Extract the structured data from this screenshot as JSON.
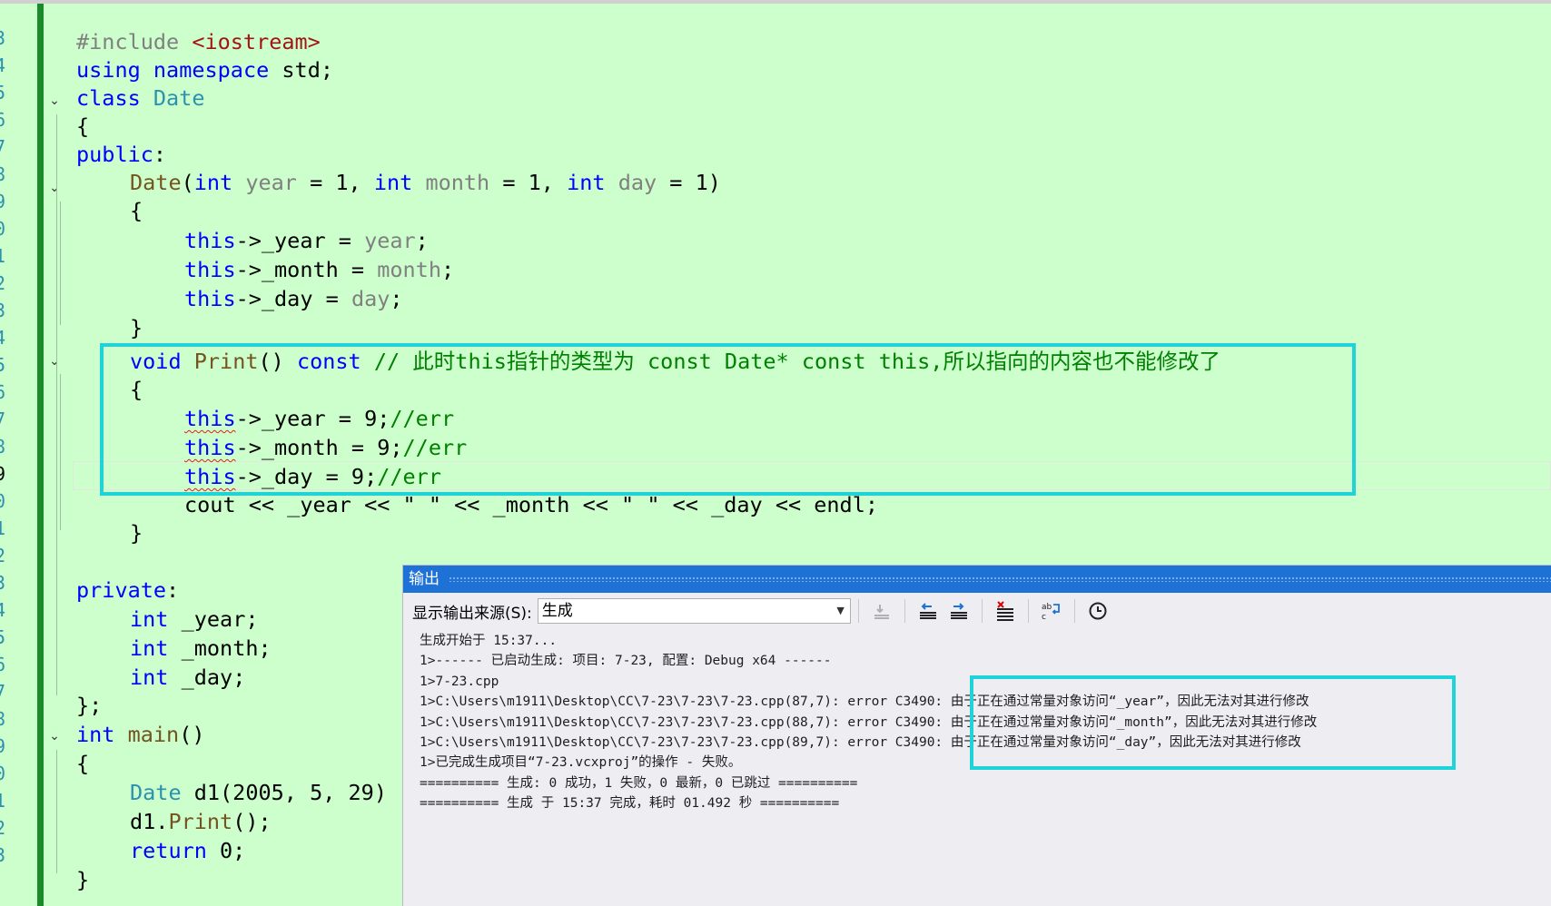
{
  "line_numbers": [
    "3",
    "4",
    "5",
    "6",
    "7",
    "8",
    "9",
    "0",
    "1",
    "2",
    "3",
    "4",
    "5",
    "6",
    "7",
    "8",
    "9",
    "0",
    "1",
    "2",
    "3",
    "4",
    "5",
    "6",
    "7",
    "8",
    "9",
    "0",
    "1",
    "2",
    "3"
  ],
  "code": {
    "l4_pp": "#include ",
    "l4_str": "<iostream>",
    "l5_kw1": "using",
    "l5_kw2": "namespace",
    "l5_rest": " std;",
    "l6_kw": "class",
    "l6_ty": "Date",
    "l7": "{",
    "l8_kw": "public",
    "l8_rest": ":",
    "l9_fn": "Date",
    "l9_p1": "(",
    "l9_int1": "int",
    "l9_year": "year",
    "l9_eq1": " = 1, ",
    "l9_int2": "int",
    "l9_month": "month",
    "l9_eq2": " = 1, ",
    "l9_int3": "int",
    "l9_day": "day",
    "l9_eq3": " = 1)",
    "l10": "{",
    "l11_this": "this",
    "l11_mid": "->_year = ",
    "l11_par": "year",
    "l11_end": ";",
    "l12_this": "this",
    "l12_mid": "->_month = ",
    "l12_par": "month",
    "l12_end": ";",
    "l13_this": "this",
    "l13_mid": "->_day = ",
    "l13_par": "day",
    "l13_end": ";",
    "l14": "}",
    "l15_void": "void",
    "l15_fn": "Print",
    "l15_paren": "() ",
    "l15_const": "const",
    "l15_comment": " // 此时this指针的类型为 const Date* const this,所以指向的内容也不能修改了",
    "l16": "{",
    "l17_this": "this",
    "l17_mid": "->_year = 9;",
    "l17_cm": "//err",
    "l18_this": "this",
    "l18_mid": "->_month = 9;",
    "l18_cm": "//err",
    "l19_this": "this",
    "l19_mid": "->_day = 9;",
    "l19_cm": "//err",
    "l20": "cout << _year << \" \" << _month << \" \" << _day << endl;",
    "l21": "}",
    "l23_kw": "private",
    "l23_rest": ":",
    "l24_int": "int",
    "l24_rest": " _year;",
    "l25_int": "int",
    "l25_rest": " _month;",
    "l26_int": "int",
    "l26_rest": " _day;",
    "l27": "};",
    "l28_int": "int",
    "l28_fn": " main",
    "l28_rest": "()",
    "l29": "{",
    "l30_ty": "Date",
    "l30_rest": " d1(2005, 5, 29)",
    "l31_d1": "d1.",
    "l31_fn": "Print",
    "l31_rest": "();",
    "l32_kw": "return",
    "l32_rest": " 0;",
    "l33": "}"
  },
  "output_panel": {
    "title": "输出",
    "source_label": "显示输出来源(S):",
    "source_value": "生成",
    "lines": [
      "生成开始于 15:37...",
      "1>------ 已启动生成: 项目: 7-23, 配置: Debug x64 ------",
      "1>7-23.cpp",
      "1>C:\\Users\\m1911\\Desktop\\CC\\7-23\\7-23\\7-23.cpp(87,7): error C3490: 由于正在通过常量对象访问“_year”，因此无法对其进行修改",
      "1>C:\\Users\\m1911\\Desktop\\CC\\7-23\\7-23\\7-23.cpp(88,7): error C3490: 由于正在通过常量对象访问“_month”，因此无法对其进行修改",
      "1>C:\\Users\\m1911\\Desktop\\CC\\7-23\\7-23\\7-23.cpp(89,7): error C3490: 由于正在通过常量对象访问“_day”，因此无法对其进行修改",
      "1>已完成生成项目“7-23.vcxproj”的操作 - 失败。",
      "========== 生成: 0 成功，1 失败，0 最新，0 已跳过 ==========",
      "========== 生成 于 15:37 完成，耗时 01.492 秒 =========="
    ]
  },
  "colors": {
    "editor_bg": "#ccffcc",
    "highlight_box": "#1fd3d8",
    "output_title_bg": "#1e72d6"
  }
}
